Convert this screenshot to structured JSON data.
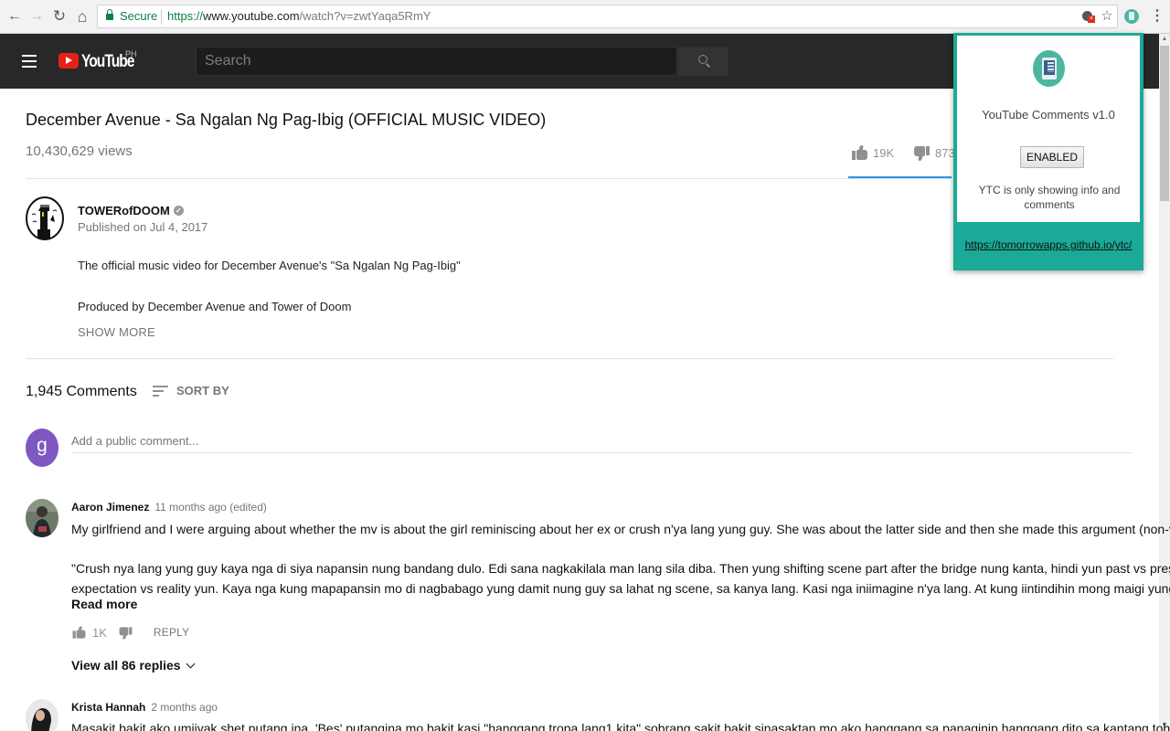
{
  "browser": {
    "secure_label": "Secure",
    "url_scheme": "https://",
    "url_host": "www.youtube.com",
    "url_path": "/watch?v=zwtYaqa5RmY",
    "icons": {
      "back": "←",
      "forward": "→",
      "reload": "↻",
      "home": "⌂",
      "bookmark": "☆",
      "menu": "⋮"
    }
  },
  "header": {
    "logo_text": "YouTube",
    "country_code": "PH",
    "search_placeholder": "Search",
    "search_value": ""
  },
  "video": {
    "title": "December Avenue - Sa Ngalan Ng Pag-Ibig (OFFICIAL MUSIC VIDEO)",
    "views": "10,430,629 views",
    "likes": "19K",
    "dislikes": "873",
    "like_ratio": 0.956,
    "channel": "TOWERofDOOM",
    "verified_glyph": "✓",
    "published": "Published on Jul 4, 2017",
    "description": [
      "The official music video for December Avenue's \"Sa Ngalan Ng Pag-Ibig\"",
      "Produced by December Avenue and Tower of Doom"
    ],
    "show_more": "SHOW MORE"
  },
  "comments": {
    "count_label": "1,945 Comments",
    "sort_label": "SORT BY",
    "user_initial": "g",
    "input_placeholder": "Add a public comment...",
    "threads": [
      {
        "author": "Aaron Jimenez",
        "time": "11 months ago (edited)",
        "lines": [
          "My girlfriend and I were arguing about whether the mv is about the girl reminiscing about her ex or crush n'ya lang yung guy. She was about the latter side and then she made this argument (non-verbatim):",
          "\"Crush nya lang yung guy kaya nga di siya napansin nung bandang dulo. Edi sana nagkakilala man lang sila diba. Then yung shifting scene part after the bridge nung kanta, hindi yun past vs present scene,",
          "expectation vs reality yun. Kaya nga kung mapapansin mo di nagbabago yung damit nung guy sa lahat ng scene, sa kanya lang. Kasi nga iniimagine n'ya lang. At kung iintindihin mong maigi yung kanta,"
        ],
        "read_more": "Read more",
        "likes": "1K",
        "reply_label": "REPLY",
        "view_replies": "View all 86 replies"
      },
      {
        "author": "Krista Hannah",
        "time": "2 months ago",
        "lines": [
          "Masakit bakit ako umiiyak shet putang ina. 'Bes' putangina mo bakit kasi \"hanggang tropa lang1 kita\" sobrang sakit bakit sinasaktan mo ako hanggang sa panaginip hanggang dito sa kantang toh. Ako"
        ]
      }
    ]
  },
  "extension_popup": {
    "title": "YouTube Comments v1.0",
    "toggle_label": "ENABLED",
    "status": "YTC is only showing info and comments",
    "link": "https://tomorrowapps.github.io/ytc/",
    "accent_color": "#1aaa97"
  },
  "scrollbar": {
    "up_glyph": "▲",
    "down_glyph": "▼"
  }
}
